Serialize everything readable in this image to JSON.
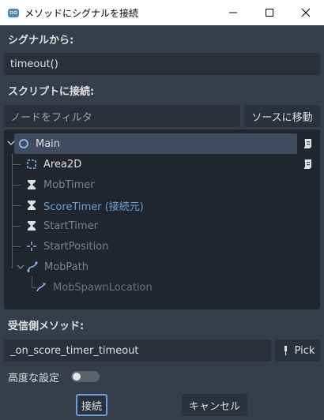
{
  "window": {
    "title": "メソッドにシグナルを接続"
  },
  "signal": {
    "section_label": "シグナルから:",
    "value": "timeout()"
  },
  "script": {
    "section_label": "スクリプトに接続:",
    "filter_placeholder": "ノードをフィルタ",
    "go_to_source_label": "ソースに移動"
  },
  "tree": {
    "nodes": [
      {
        "label": "Main",
        "icon": "node-circle-icon"
      },
      {
        "label": "Area2D",
        "icon": "area2d-icon"
      },
      {
        "label": "MobTimer",
        "icon": "timer-icon"
      },
      {
        "label": "ScoreTimer (接続元)",
        "icon": "timer-icon"
      },
      {
        "label": "StartTimer",
        "icon": "timer-icon"
      },
      {
        "label": "StartPosition",
        "icon": "position2d-icon"
      },
      {
        "label": "MobPath",
        "icon": "path2d-icon"
      },
      {
        "label": "MobSpawnLocation",
        "icon": "pathfollow-icon"
      }
    ]
  },
  "receiver": {
    "section_label": "受信側メソッド:",
    "method": "_on_score_timer_timeout",
    "pick_label": "Pick"
  },
  "advanced": {
    "label": "高度な設定",
    "enabled": false
  },
  "buttons": {
    "connect": "接続",
    "cancel": "キャンセル"
  },
  "colors": {
    "accent": "#6a9fd8",
    "background": "#363d4a",
    "tree_bg": "#21262e"
  }
}
